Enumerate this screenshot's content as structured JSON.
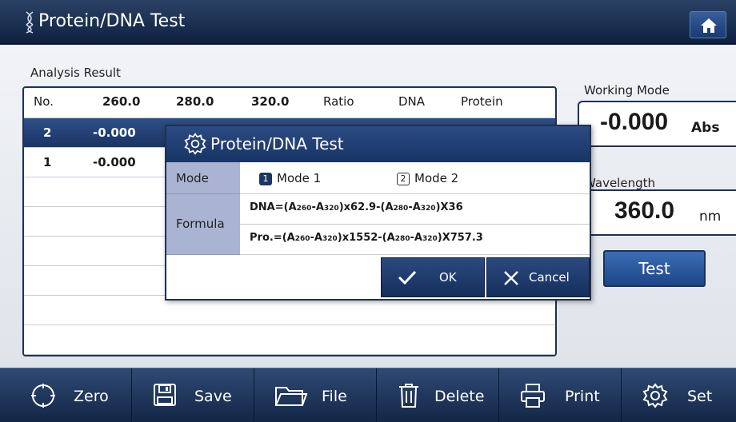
{
  "window": {
    "title": "Protein/DNA Test"
  },
  "results": {
    "section_label": "Analysis Result",
    "columns": [
      "No.",
      "260.0",
      "280.0",
      "320.0",
      "Ratio",
      "DNA",
      "Protein"
    ],
    "rows": [
      {
        "no": "2",
        "a260": "-0.000",
        "selected": true
      },
      {
        "no": "1",
        "a260": "-0.000",
        "selected": false
      }
    ]
  },
  "working_mode": {
    "label": "Working Mode",
    "value": "-0.000",
    "unit": "Abs"
  },
  "wavelength": {
    "label": "Wavelength",
    "value": "360.0",
    "unit": "nm"
  },
  "test_button": "Test",
  "toolbar": {
    "zero": "Zero",
    "save": "Save",
    "file": "File",
    "delete": "Delete",
    "print": "Print",
    "set": "Set"
  },
  "dialog": {
    "title": "Protein/DNA Test",
    "mode_label": "Mode",
    "mode1_num": "1",
    "mode1": "Mode 1",
    "mode2_num": "2",
    "mode2": "Mode 2",
    "formula_label": "Formula",
    "dna_formula": {
      "p1": "DNA=(A",
      "s1": "260",
      "p2": "-A",
      "s2": "320",
      "p3": ")x62.9-(A",
      "s3": "280",
      "p4": "-A",
      "s4": "320",
      "p5": ")X36"
    },
    "pro_formula": {
      "p1": "Pro.=(A",
      "s1": "260",
      "p2": "-A",
      "s2": "320",
      "p3": ")x1552-(A",
      "s3": "280",
      "p4": "-A",
      "s4": "320",
      "p5": ")X757.3"
    },
    "ok": "OK",
    "cancel": "Cancel"
  },
  "icons": {
    "home": "home-icon",
    "dna": "dna-icon",
    "gear": "gear-icon",
    "zero": "circle-target-icon",
    "save": "floppy-disk-icon",
    "file": "folder-icon",
    "delete": "trash-icon",
    "print": "printer-icon",
    "set": "gear-icon",
    "ok": "check-icon",
    "cancel": "x-icon"
  },
  "colors": {
    "accent": "#1d3565",
    "toolbar": "#1c325a",
    "panel": "#aab4d2"
  }
}
